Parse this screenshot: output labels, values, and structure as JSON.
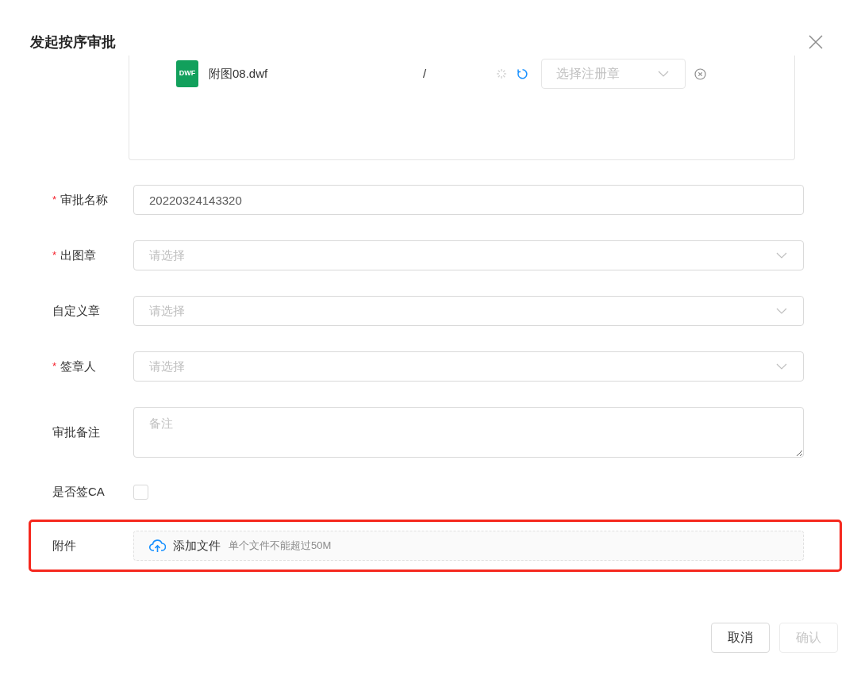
{
  "dialog": {
    "title": "发起按序审批"
  },
  "file_list": [
    {
      "icon_label": "DWF",
      "name": "附图08.dwf",
      "separator": "/",
      "select_placeholder": "选择注册章"
    }
  ],
  "fields": [
    {
      "kind": "input",
      "label": "审批名称",
      "required_mark": "*",
      "value": "20220324143320"
    },
    {
      "kind": "select",
      "label": "出图章",
      "required_mark": "*",
      "placeholder": "请选择"
    },
    {
      "kind": "select",
      "label": "自定义章",
      "placeholder": "请选择"
    },
    {
      "kind": "select",
      "label": "签章人",
      "required_mark": "*",
      "placeholder": "请选择"
    },
    {
      "kind": "textarea",
      "label": "审批备注",
      "placeholder": "备注"
    },
    {
      "kind": "checkbox",
      "label": "是否签CA",
      "checked": false
    },
    {
      "kind": "upload",
      "label": "附件",
      "button": "添加文件",
      "hint": "单个文件不能超过50M",
      "highlighted": true
    }
  ],
  "buttons": [
    {
      "label": "取消",
      "disabled": false
    },
    {
      "label": "确认",
      "disabled": true
    }
  ]
}
